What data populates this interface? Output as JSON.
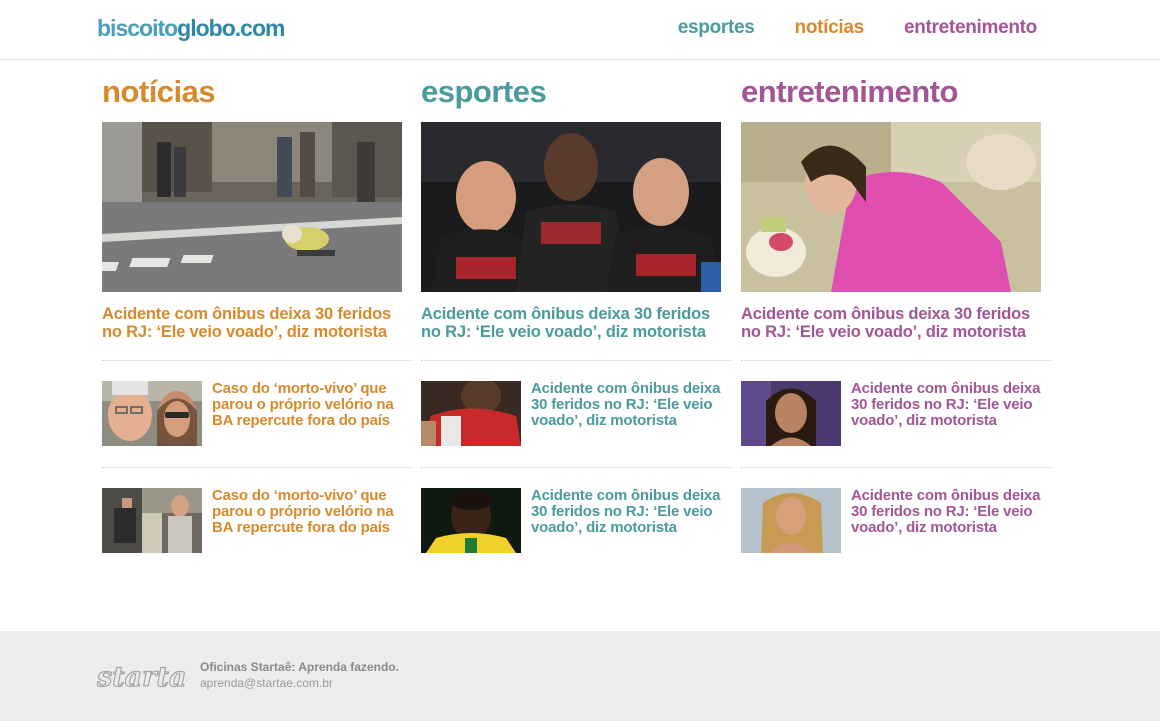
{
  "site": {
    "logo_part1": "biscoito",
    "logo_part2": "globo.com"
  },
  "nav": [
    {
      "label": "esportes",
      "color": "#4a9a9e"
    },
    {
      "label": "notícias",
      "color": "#d88a2b"
    },
    {
      "label": "entretenimento",
      "color": "#a25696"
    }
  ],
  "columns": [
    {
      "title": "notícias",
      "color": "#d88a2b",
      "hero_headline": "Acidente com ônibus deixa 30 feridos no RJ: ‘Ele veio voado’, diz motorista",
      "items": [
        {
          "text": "Caso do ‘morto-vivo’ que parou o próprio velório na BA repercute fora do país"
        },
        {
          "text": "Caso do ‘morto-vivo’ que parou o próprio velório na BA repercute fora do país"
        }
      ]
    },
    {
      "title": "esportes",
      "color": "#4a9a9e",
      "hero_headline": "Acidente com ônibus deixa 30 feridos no RJ: ‘Ele veio voado’, diz motorista",
      "items": [
        {
          "text": "Acidente com ônibus deixa 30 feridos no RJ: ‘Ele veio voado’, diz motorista"
        },
        {
          "text": "Acidente com ônibus deixa 30 feridos no RJ: ‘Ele veio voado’, diz motorista"
        }
      ]
    },
    {
      "title": "entretenimento",
      "color": "#a25696",
      "hero_headline": "Acidente com ônibus deixa 30 feridos no RJ: ‘Ele veio voado’, diz motorista",
      "items": [
        {
          "text": "Acidente com ônibus deixa 30 feridos no RJ: ‘Ele veio voado’, diz motorista"
        },
        {
          "text": "Acidente com ônibus deixa 30 feridos no RJ: ‘Ele veio voado’, diz motorista"
        }
      ]
    }
  ],
  "footer": {
    "brand": "startaê",
    "tagline": "Oficinas Startaê: Aprenda fazendo.",
    "email": "aprenda@startae.com.br"
  }
}
